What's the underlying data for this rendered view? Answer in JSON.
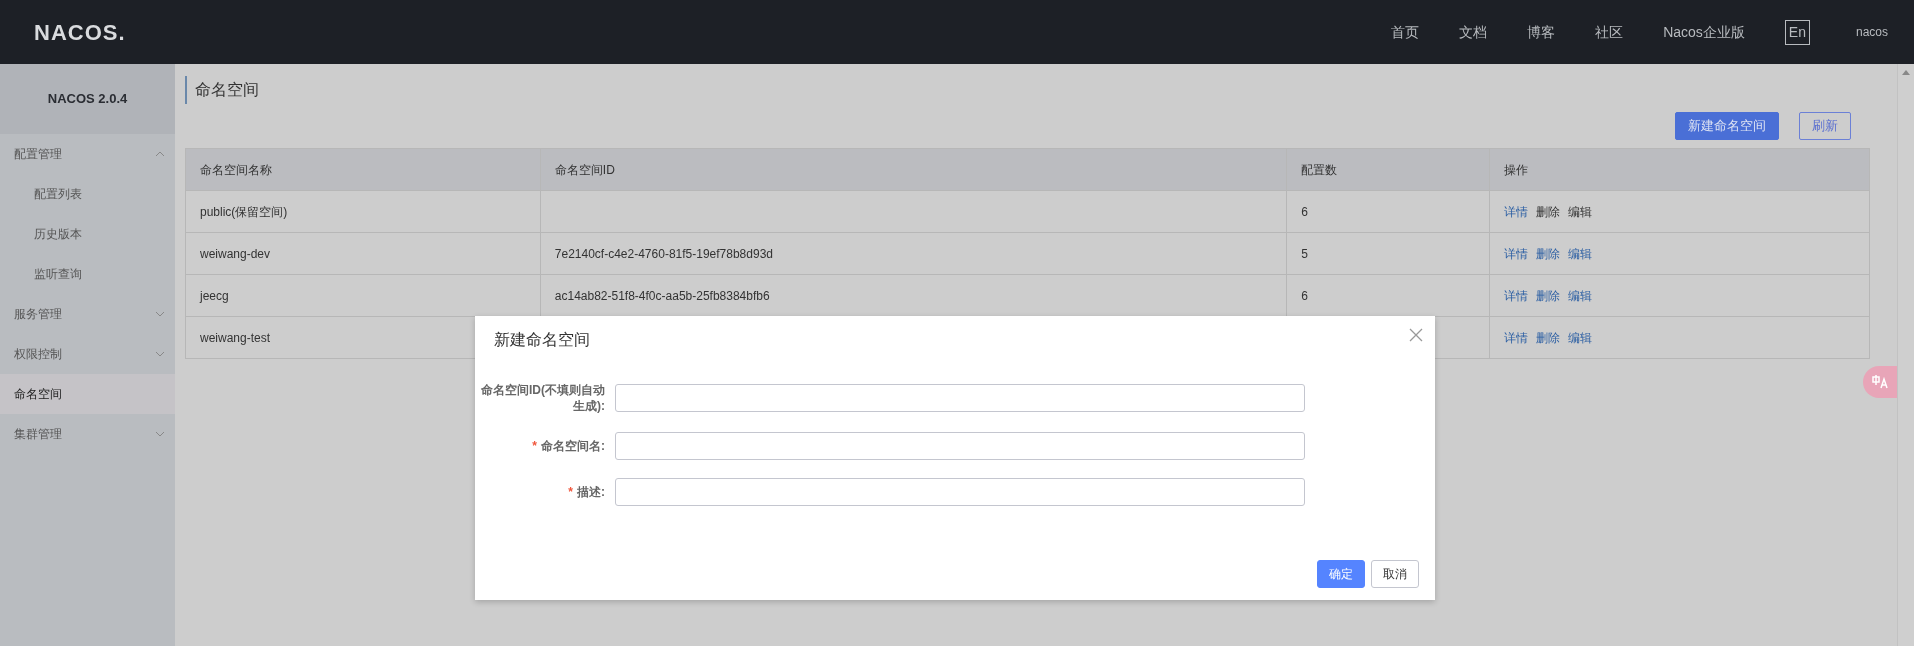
{
  "header": {
    "logo": "NACOS.",
    "nav": [
      {
        "label": "首页",
        "kind": "link"
      },
      {
        "label": "文档",
        "kind": "link"
      },
      {
        "label": "博客",
        "kind": "link"
      },
      {
        "label": "社区",
        "kind": "link"
      },
      {
        "label": "Nacos企业版",
        "kind": "link"
      },
      {
        "label": "En",
        "kind": "boxed"
      },
      {
        "label": "nacos",
        "kind": "user"
      }
    ]
  },
  "sidebar": {
    "title": "NACOS 2.0.4",
    "items": [
      {
        "label": "配置管理",
        "kind": "group",
        "expanded": true,
        "selected": false,
        "children": [
          {
            "label": "配置列表",
            "selected": false
          },
          {
            "label": "历史版本",
            "selected": false
          },
          {
            "label": "监听查询",
            "selected": false
          }
        ]
      },
      {
        "label": "服务管理",
        "kind": "group",
        "expanded": false,
        "selected": false
      },
      {
        "label": "权限控制",
        "kind": "group",
        "expanded": false,
        "selected": false
      },
      {
        "label": "命名空间",
        "kind": "link",
        "selected": true
      },
      {
        "label": "集群管理",
        "kind": "group",
        "expanded": false,
        "selected": false
      }
    ]
  },
  "page": {
    "title": "命名空间",
    "buttons": [
      {
        "label": "新建命名空间",
        "kind": "primary"
      },
      {
        "label": "刷新",
        "kind": "outline"
      }
    ]
  },
  "table": {
    "columns": [
      "命名空间名称",
      "命名空间ID",
      "配置数",
      "操作"
    ],
    "rows": [
      {
        "name": "public(保留空间)",
        "count": "6",
        "actions": [
          {
            "label": "详情",
            "disabled": false
          },
          {
            "label": "删除",
            "disabled": true
          },
          {
            "label": "编辑",
            "disabled": true
          }
        ]
      },
      {
        "name": "weiwang-dev",
        "id": "7e2140cf-c4e2-4760-81f5-19ef78b8d93d",
        "count": "5",
        "actions": [
          {
            "label": "详情",
            "disabled": false
          },
          {
            "label": "删除",
            "disabled": false
          },
          {
            "label": "编辑",
            "disabled": false
          }
        ]
      },
      {
        "name": "jeecg",
        "id": "ac14ab82-51f8-4f0c-aa5b-25fb8384bfb6",
        "count": "6",
        "actions": [
          {
            "label": "详情",
            "disabled": false
          },
          {
            "label": "删除",
            "disabled": false
          },
          {
            "label": "编辑",
            "disabled": false
          }
        ]
      },
      {
        "name": "weiwang-test",
        "actions": [
          {
            "label": "详情",
            "disabled": false
          },
          {
            "label": "删除",
            "disabled": false
          },
          {
            "label": "编辑",
            "disabled": false
          }
        ]
      }
    ]
  },
  "dialog": {
    "title": "新建命名空间",
    "fields": [
      {
        "label": "命名空间ID(不填则自动生成):"
      },
      {
        "label": "命名空间名:",
        "required_mark": "*"
      },
      {
        "label": "描述:",
        "required_mark": "*"
      }
    ],
    "buttons": [
      {
        "label": "确定",
        "kind": "primary"
      },
      {
        "label": "取消",
        "kind": "default"
      }
    ]
  }
}
